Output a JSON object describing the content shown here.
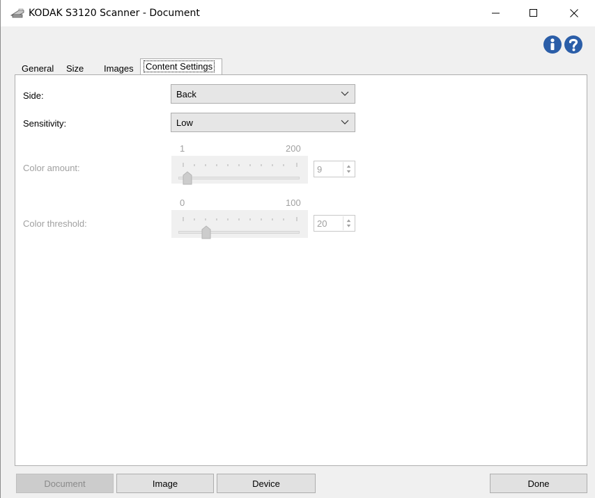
{
  "window": {
    "title": "KODAK S3120 Scanner - Document"
  },
  "tabs": [
    {
      "label": "General"
    },
    {
      "label": "Size"
    },
    {
      "label": "Images"
    },
    {
      "label": "Content Settings",
      "selected": true
    }
  ],
  "content": {
    "side": {
      "label": "Side:",
      "value": "Back"
    },
    "sensitivity": {
      "label": "Sensitivity:",
      "value": "Low"
    },
    "color_amount": {
      "label": "Color amount:",
      "min": "1",
      "max": "200",
      "value": "9",
      "enabled": false
    },
    "color_threshold": {
      "label": "Color threshold:",
      "min": "0",
      "max": "100",
      "value": "20",
      "enabled": false
    }
  },
  "buttons": {
    "document": "Document",
    "image": "Image",
    "device": "Device",
    "done": "Done"
  },
  "icons": {
    "app": "scanner-icon",
    "info": "info-icon",
    "help": "question-icon",
    "accent": "#2b5ea8"
  }
}
